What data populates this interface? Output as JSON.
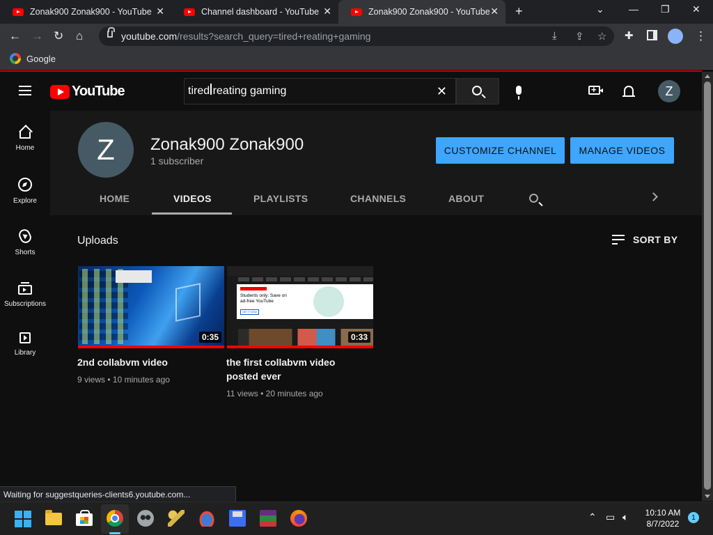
{
  "browser": {
    "tabs": [
      {
        "title": "Zonak900 Zonak900 - YouTube"
      },
      {
        "title": "Channel dashboard - YouTube Studio"
      },
      {
        "title": "Zonak900 Zonak900 - YouTube"
      }
    ],
    "url_host": "youtube.com",
    "url_path": "/results?search_query=tired+reating+gaming",
    "bookmark": "Google",
    "status_text": "Waiting for suggestqueries-clients6.youtube.com..."
  },
  "masthead": {
    "logo_text": "YouTube",
    "search_value": "tired reating gaming",
    "avatar_letter": "Z"
  },
  "guide": {
    "items": [
      {
        "label": "Home",
        "icon": "home-icon"
      },
      {
        "label": "Explore",
        "icon": "compass-icon"
      },
      {
        "label": "Shorts",
        "icon": "shorts-icon"
      },
      {
        "label": "Subscriptions",
        "icon": "subscriptions-icon"
      },
      {
        "label": "Library",
        "icon": "library-icon"
      }
    ]
  },
  "channel": {
    "avatar_letter": "Z",
    "name": "Zonak900 Zonak900",
    "subscribers": "1 subscriber",
    "customize_label": "CUSTOMIZE CHANNEL",
    "manage_label": "MANAGE VIDEOS",
    "tabs": [
      "HOME",
      "VIDEOS",
      "PLAYLISTS",
      "CHANNELS",
      "ABOUT"
    ],
    "active_tab": "VIDEOS",
    "accent_color": "#3ea6ff"
  },
  "uploads": {
    "heading": "Uploads",
    "sort_label": "SORT BY",
    "videos": [
      {
        "title": "2nd collabvm video",
        "duration": "0:35",
        "views": "9 views",
        "age": "10 minutes ago",
        "progress": 1.0
      },
      {
        "title": "the first collabvm video posted ever",
        "duration": "0:33",
        "views": "11 views",
        "age": "20 minutes ago",
        "progress": 1.0
      }
    ],
    "thumb2_text": {
      "brand": "YouTube Premium",
      "headline": "Students only: Save on ad-free YouTube",
      "cta": "GET IT NOW"
    }
  },
  "taskbar": {
    "time": "10:10 AM",
    "date": "8/7/2022",
    "notification_count": "1"
  }
}
